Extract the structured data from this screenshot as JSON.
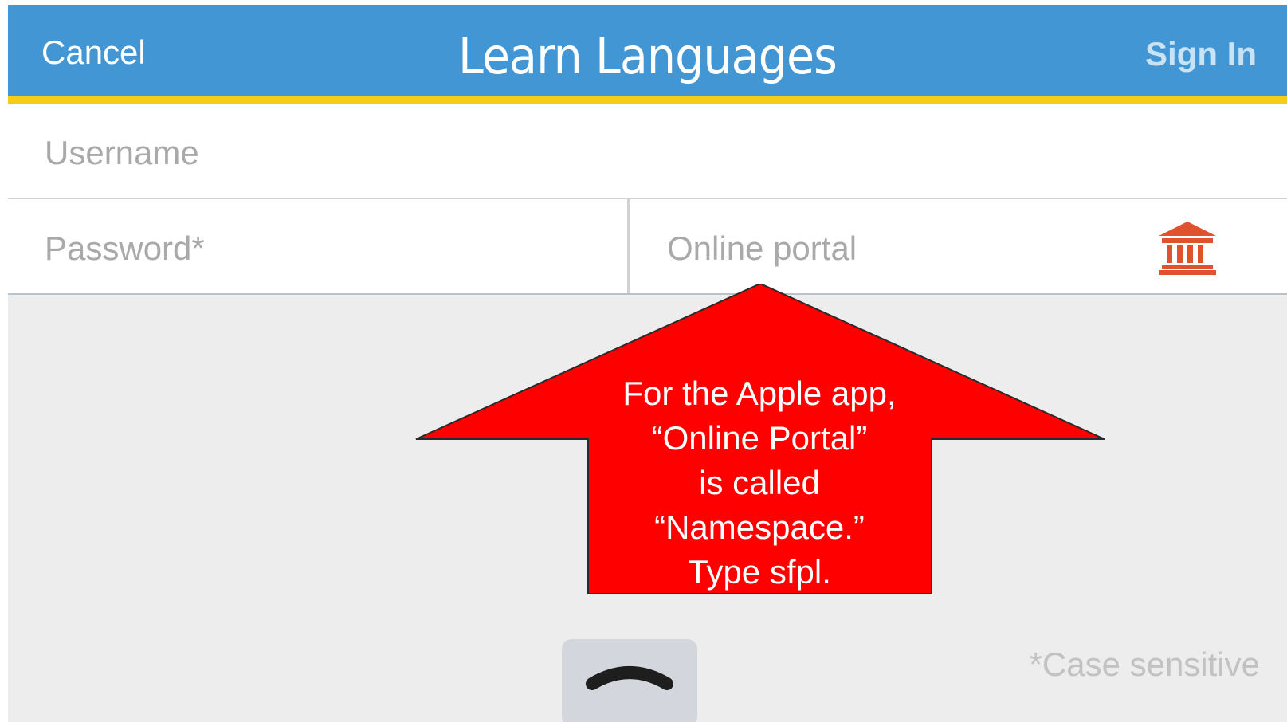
{
  "navbar": {
    "cancel_label": "Cancel",
    "title": "Learn Languages",
    "signin_label": "Sign In",
    "bar_color": "#4396d4",
    "stripe_color": "#f4cd1a"
  },
  "form": {
    "username_placeholder": "Username",
    "password_placeholder": "Password*",
    "portal_placeholder": "Online portal",
    "portal_icon": "institution-icon",
    "icon_color": "#e0522e"
  },
  "annotation": {
    "lines": [
      "For the Apple app,",
      "“Online Portal”",
      "is called",
      "“Namespace.”",
      "Type sfpl."
    ],
    "arrow_color": "#ff0000",
    "arrow_icon": "up-arrow-callout"
  },
  "footer": {
    "case_note": "*Case sensitive",
    "expand_icon": "chevron-up-icon"
  }
}
